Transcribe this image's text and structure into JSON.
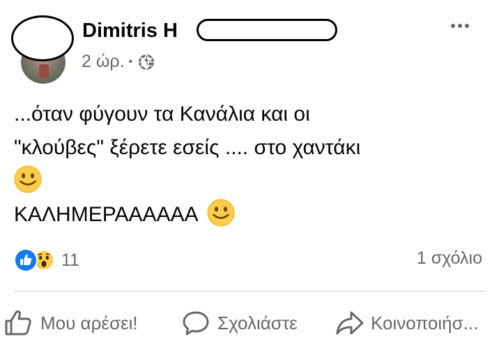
{
  "post": {
    "author_name": "Dimitris H",
    "time": "2 ώρ.",
    "separator": "•",
    "privacy_icon": "globe-icon",
    "more_icon": "more-horizontal-icon",
    "text_lines": [
      "...όταν φύγουν τα Κανάλια και οι",
      "\"κλούβες\" ξέρετε εσείς .... στο χαντάκι",
      "",
      "ΚΑΛΗΜΕΡΑΑΑΑΑΑ"
    ],
    "emoji": "slightly-smiling-face"
  },
  "reactions": {
    "types": [
      "like",
      "wow"
    ],
    "count": "11",
    "comments": "1 σχόλιο"
  },
  "actions": {
    "like_label": "Μου αρέσει!",
    "comment_label": "Σχολιάστε",
    "share_label": "Κοινοποιήσ..."
  },
  "colors": {
    "text": "#050505",
    "secondary": "#65676b",
    "like_blue": "#1877f2",
    "emoji_yellow": "#ffcc4d"
  }
}
